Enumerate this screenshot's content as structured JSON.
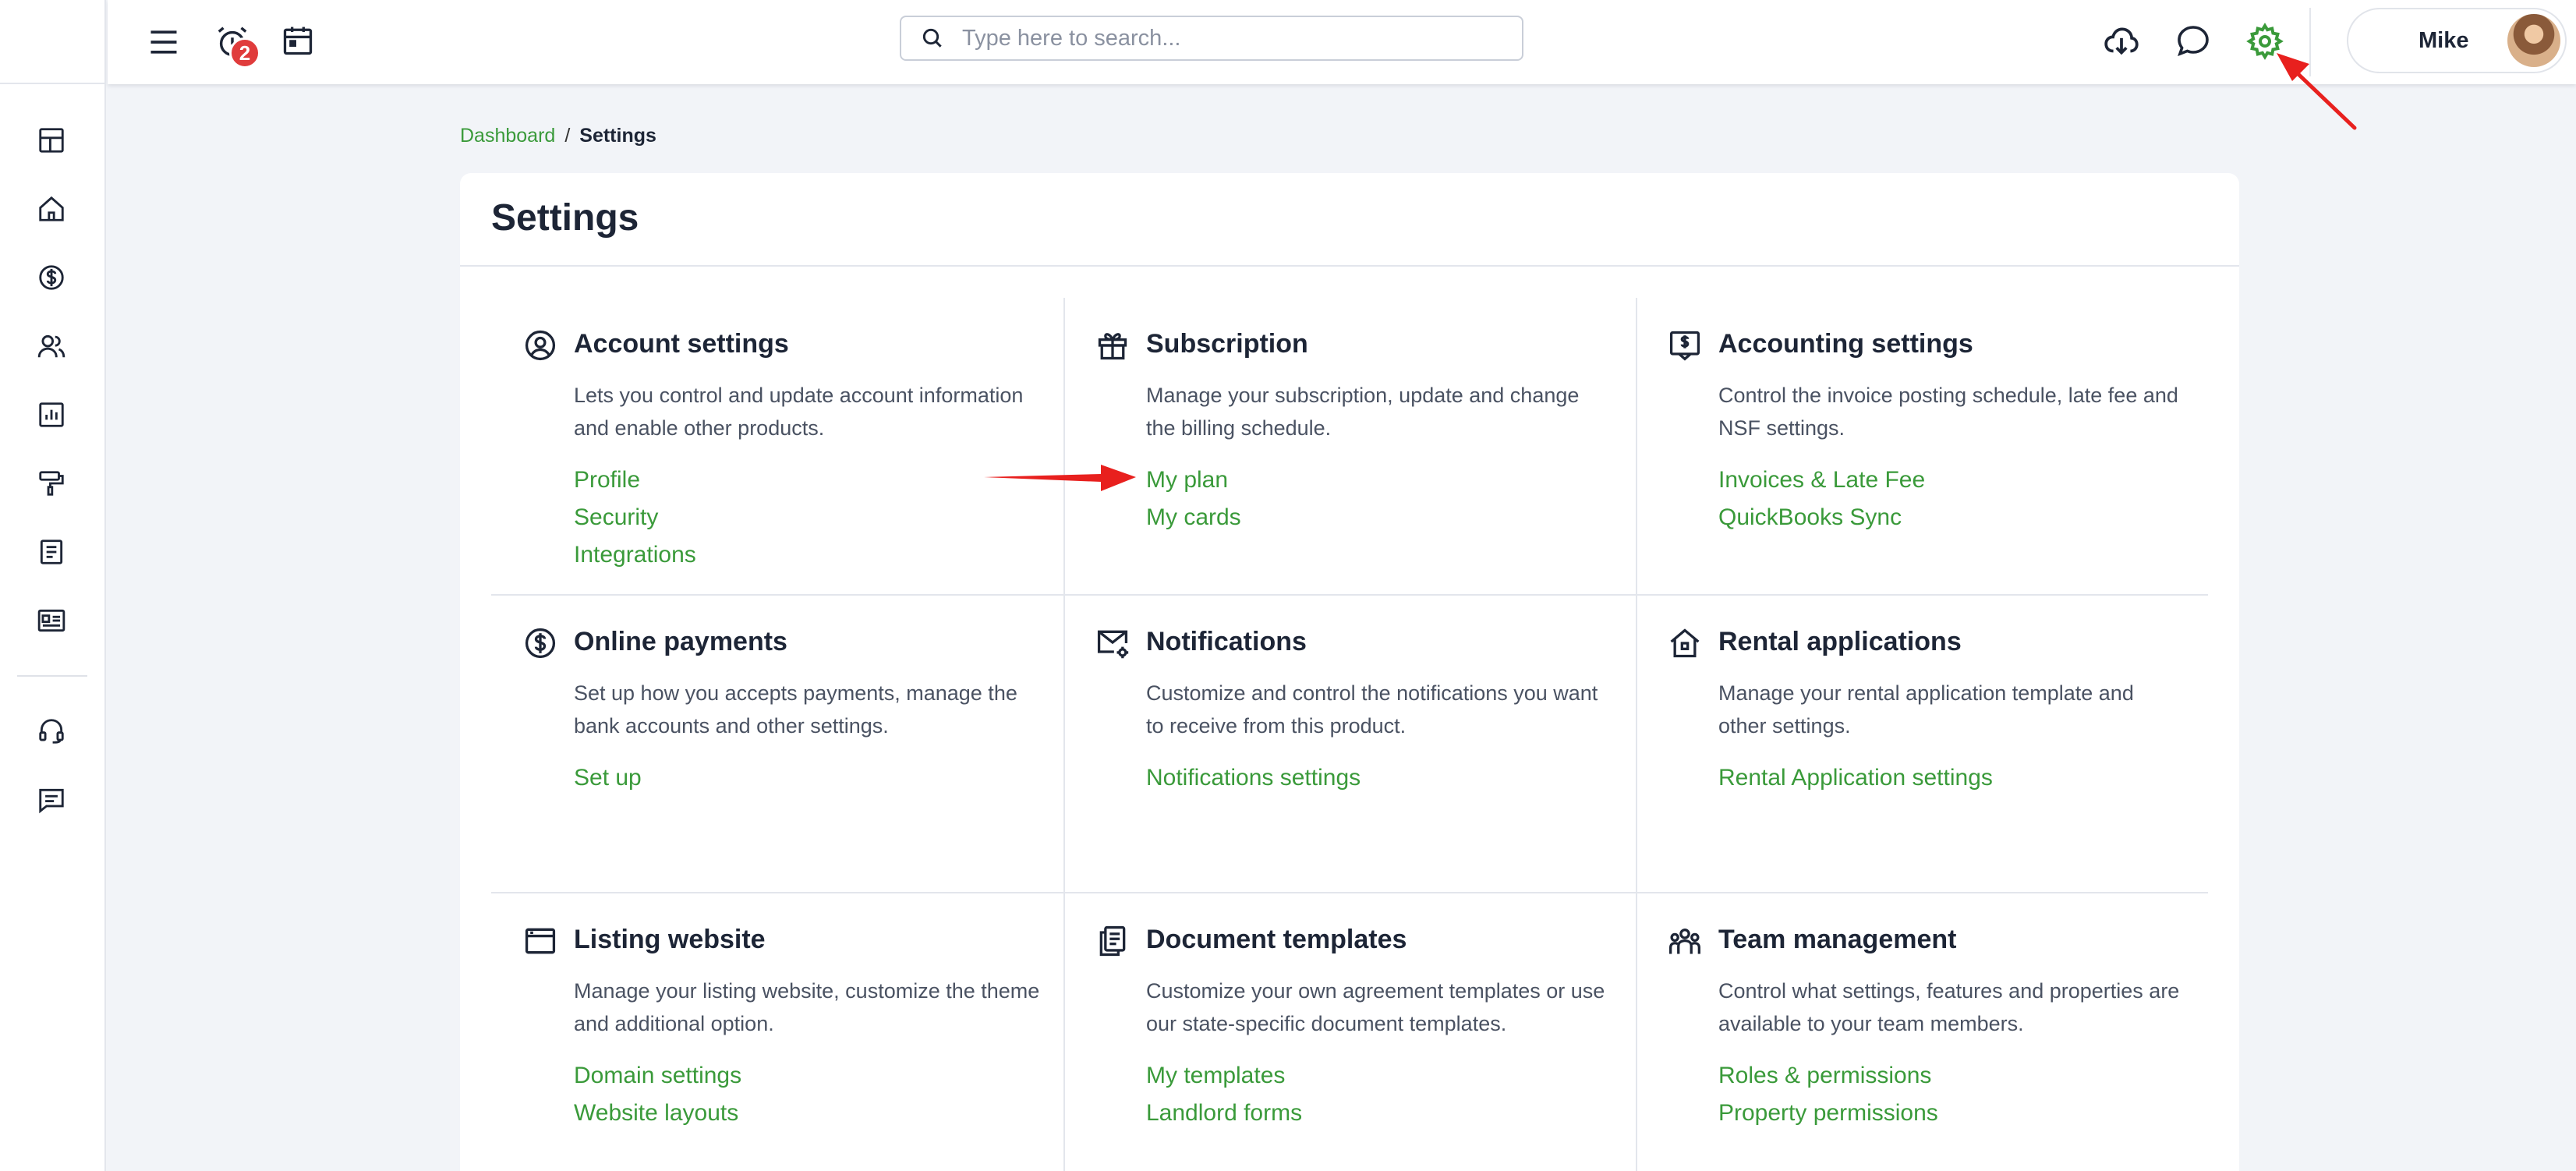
{
  "topbar": {
    "notifications_count": "2",
    "search_placeholder": "Type here to search...",
    "user_name": "Mike"
  },
  "breadcrumb": {
    "home": "Dashboard",
    "separator": "/",
    "current": "Settings"
  },
  "page_title": "Settings",
  "colors": {
    "accent_green": "#3a9a3a",
    "annotation_red": "#e8201e",
    "badge_red": "#e03c3c"
  },
  "sections": [
    {
      "icon": "user-circle-icon",
      "title": "Account settings",
      "description": "Lets you control and update account information and enable other products.",
      "links": [
        "Profile",
        "Security",
        "Integrations"
      ]
    },
    {
      "icon": "gift-icon",
      "title": "Subscription",
      "description": "Manage your subscription, update and change the billing schedule.",
      "links": [
        "My plan",
        "My cards"
      ]
    },
    {
      "icon": "ledger-icon",
      "title": "Accounting settings",
      "description": "Control the invoice posting schedule, late fee and NSF settings.",
      "links": [
        "Invoices & Late Fee",
        "QuickBooks Sync"
      ]
    },
    {
      "icon": "dollar-circle-icon",
      "title": "Online payments",
      "description": "Set up how you accepts payments, manage the bank accounts and other settings.",
      "links": [
        "Set up"
      ]
    },
    {
      "icon": "mail-gear-icon",
      "title": "Notifications",
      "description": "Customize and control the notifications you want to receive from this product.",
      "links": [
        "Notifications settings"
      ]
    },
    {
      "icon": "house-icon",
      "title": "Rental applications",
      "description": "Manage your rental application template and other settings.",
      "links": [
        "Rental Application settings"
      ]
    },
    {
      "icon": "browser-window-icon",
      "title": "Listing website",
      "description": "Manage your listing website, customize the theme and additional option.",
      "links": [
        "Domain settings",
        "Website layouts"
      ]
    },
    {
      "icon": "documents-icon",
      "title": "Document templates",
      "description": "Customize your own agreement templates or use our state-specific document templates.",
      "links": [
        "My templates",
        "Landlord forms"
      ]
    },
    {
      "icon": "team-icon",
      "title": "Team management",
      "description": "Control what settings, features and properties are available to your team members.",
      "links": [
        "Roles & permissions",
        "Property permissions"
      ]
    }
  ]
}
